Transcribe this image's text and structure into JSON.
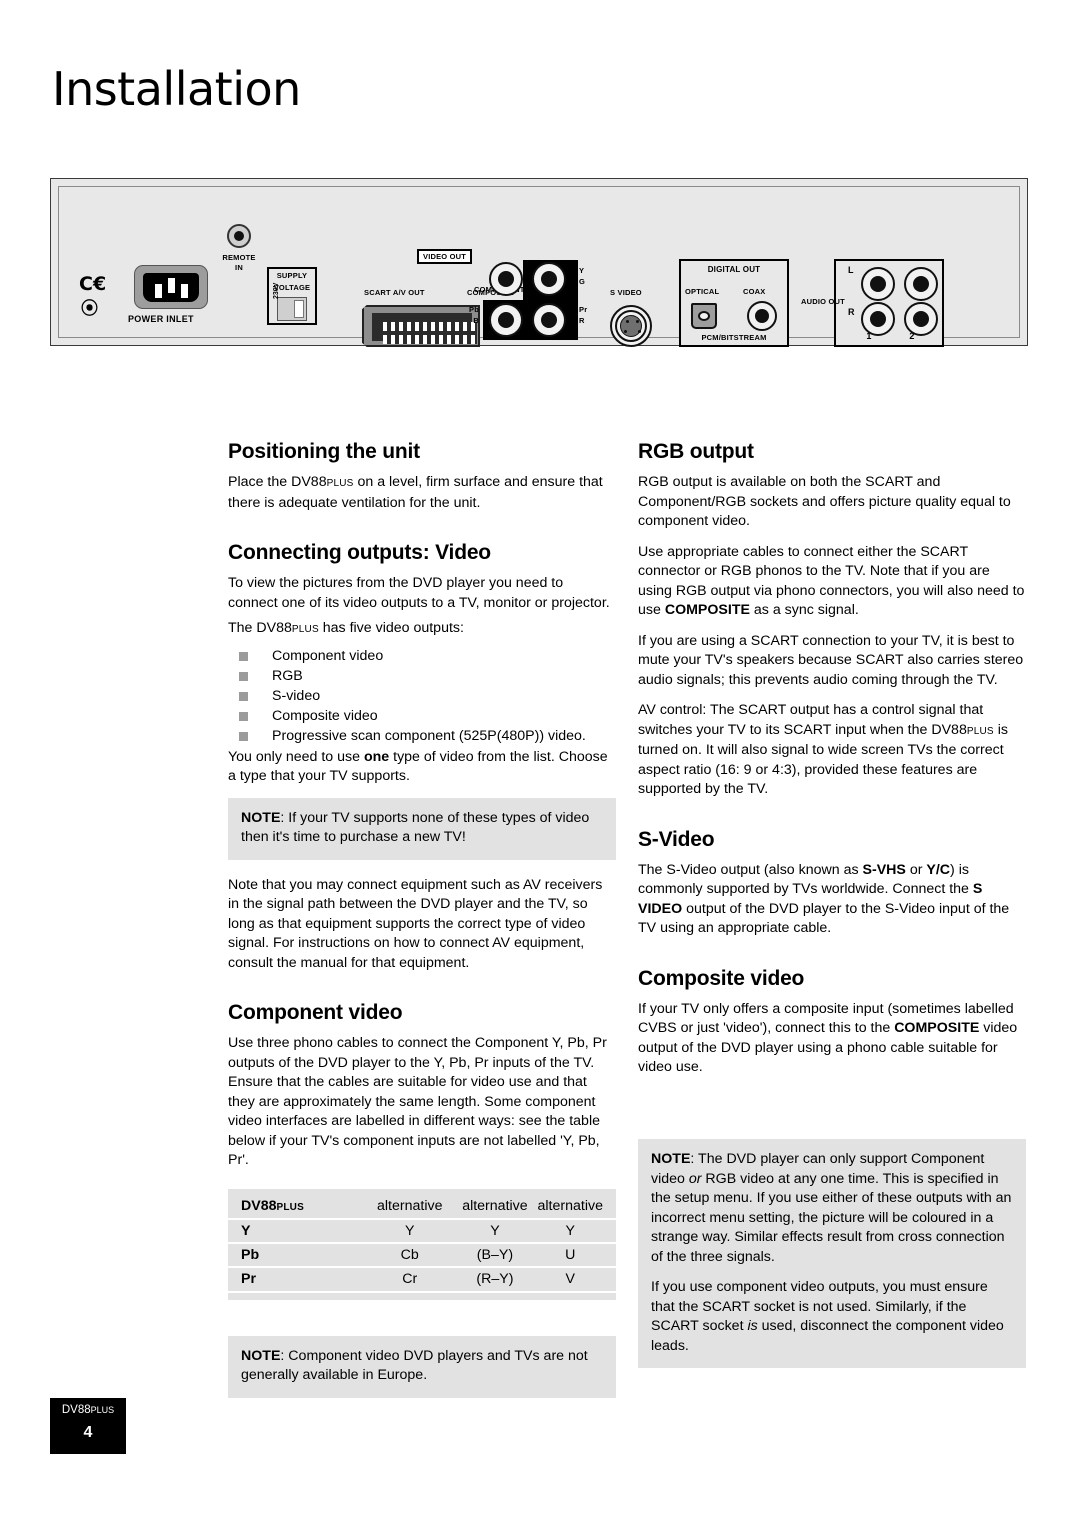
{
  "page": {
    "title": "Installation",
    "footer_model": "DV88",
    "footer_model_sub": "PLUS",
    "footer_page": "4"
  },
  "rear_panel": {
    "ce_mark": "CE",
    "ctick_mark": "C",
    "power_inlet": "POWER INLET",
    "remote_in_line1": "REMOTE",
    "remote_in_line2": "IN",
    "supply_line1": "SUPPLY",
    "supply_line2": "VOLTAGE",
    "supply_voltage_value": "230V",
    "scart": "SCART A/V OUT",
    "video_out": "VIDEO OUT",
    "composite": "COMPOSITE",
    "component": "COMPONENT",
    "component_y": "Y",
    "component_g": "G",
    "component_pr": "Pr",
    "component_r": "R",
    "component_pb": "Pb",
    "component_b": "B",
    "s_video": "S VIDEO",
    "digital_out": "DIGITAL OUT",
    "optical": "OPTICAL",
    "coax": "COAX",
    "pcm_bitstream": "PCM/BITSTREAM",
    "audio_out": "AUDIO OUT",
    "audio_l": "L",
    "audio_r": "R",
    "audio_1": "1",
    "audio_2": "2"
  },
  "left_column": {
    "positioning_heading": "Positioning the unit",
    "positioning_p1_a": "Place the DV88",
    "positioning_p1_sub": "PLUS",
    "positioning_p1_b": " on a level, firm surface and ensure that there is adequate ventilation for the unit.",
    "connecting_heading": "Connecting outputs:  Video",
    "connecting_p1": "To view the pictures from the DVD player you need to connect one of its video outputs to a TV, monitor or projector.",
    "connecting_p2_a": "The DV88",
    "connecting_p2_sub": "PLUS",
    "connecting_p2_b": " has five video outputs:",
    "outputs_list": [
      "Component video",
      "RGB",
      "S-video",
      "Composite video",
      "Progressive scan component (525P(480P)) video."
    ],
    "choose_a": "You only need to use ",
    "choose_bold": "one",
    "choose_b": " type of video from the list. Choose a type that your TV supports.",
    "note1_label": "NOTE",
    "note1_text": ": If your TV supports none of these types of video then it's time to purchase a new TV!",
    "av_paragraph": "Note that you may connect equipment such as AV receivers in the signal path between the DVD player and the TV, so long as that equipment supports the correct type of video signal. For instructions on how to connect AV equipment, consult the manual for that equipment.",
    "component_heading": "Component video",
    "component_p1": "Use three phono cables to connect the Component Y, Pb, Pr outputs of the DVD player to the Y, Pb, Pr inputs of the TV. Ensure that the cables are suitable for video use and that they are approximately the same length. Some component video interfaces are labelled in different ways: see the table below if your TV's component inputs are not labelled 'Y, Pb, Pr'.",
    "table": {
      "header": [
        "DV88",
        "alternative",
        "alternative",
        "alternative"
      ],
      "header_model_sub": "PLUS",
      "rows": [
        [
          "Y",
          "Y",
          "Y",
          "Y"
        ],
        [
          "Pb",
          "Cb",
          "(B–Y)",
          "U"
        ],
        [
          "Pr",
          "Cr",
          "(R–Y)",
          "V"
        ]
      ]
    },
    "note2_label": "NOTE",
    "note2_text": ": Component video DVD players and TVs are not generally available in Europe."
  },
  "right_column": {
    "rgb_heading": "RGB output",
    "rgb_p1": "RGB output is available on both the SCART and Component/RGB sockets and offers picture quality equal to component video.",
    "rgb_p2_a": "Use appropriate cables to connect either the SCART connector or RGB phonos to the TV. Note that if you are using RGB output via phono connectors, you will also need to use ",
    "rgb_p2_bold": "COMPOSITE",
    "rgb_p2_b": " as a sync signal.",
    "rgb_p3": "If you are using a SCART connection to your TV, it is best to mute your TV's speakers because SCART also carries stereo audio signals; this prevents audio coming through the TV.",
    "rgb_p4_a": "AV control: The SCART output has a control signal that switches your TV to its SCART input when the DV88",
    "rgb_p4_sub": "PLUS",
    "rgb_p4_b": " is turned on. It will also signal to wide screen TVs the correct aspect ratio (16: 9 or 4:3), provided these features are supported by the TV.",
    "svideo_heading": "S-Video",
    "svideo_p1_a": "The S-Video output (also known as ",
    "svideo_p1_b1": "S-VHS",
    "svideo_p1_b": " or ",
    "svideo_p1_b2": "Y/C",
    "svideo_p1_c": ") is commonly supported by TVs worldwide. Connect the ",
    "svideo_p1_b3": "S VIDEO",
    "svideo_p1_d": " output of the DVD player to the S-Video input of the TV using an appropriate cable.",
    "composite_heading": "Composite video",
    "composite_p1_a": "If your TV only offers a composite input (sometimes labelled CVBS or just 'video'), connect this to the ",
    "composite_p1_bold": "COMPOSITE",
    "composite_p1_b": " video output of the DVD player using a phono cable suitable for video use.",
    "note_label": "NOTE",
    "note_p1_a": ": The DVD player can only support Component video ",
    "note_p1_italic": "or",
    "note_p1_b": " RGB video at any one time. This is specified in the setup menu. If you use either of these outputs with an incorrect menu setting, the picture will be coloured in a strange way. Similar effects result from cross connection of the three signals.",
    "note_p2_a": "If you use component video outputs, you must ensure that the SCART socket is not used. Similarly, if the SCART socket ",
    "note_p2_italic": "is",
    "note_p2_b": " used, disconnect the component video leads."
  }
}
